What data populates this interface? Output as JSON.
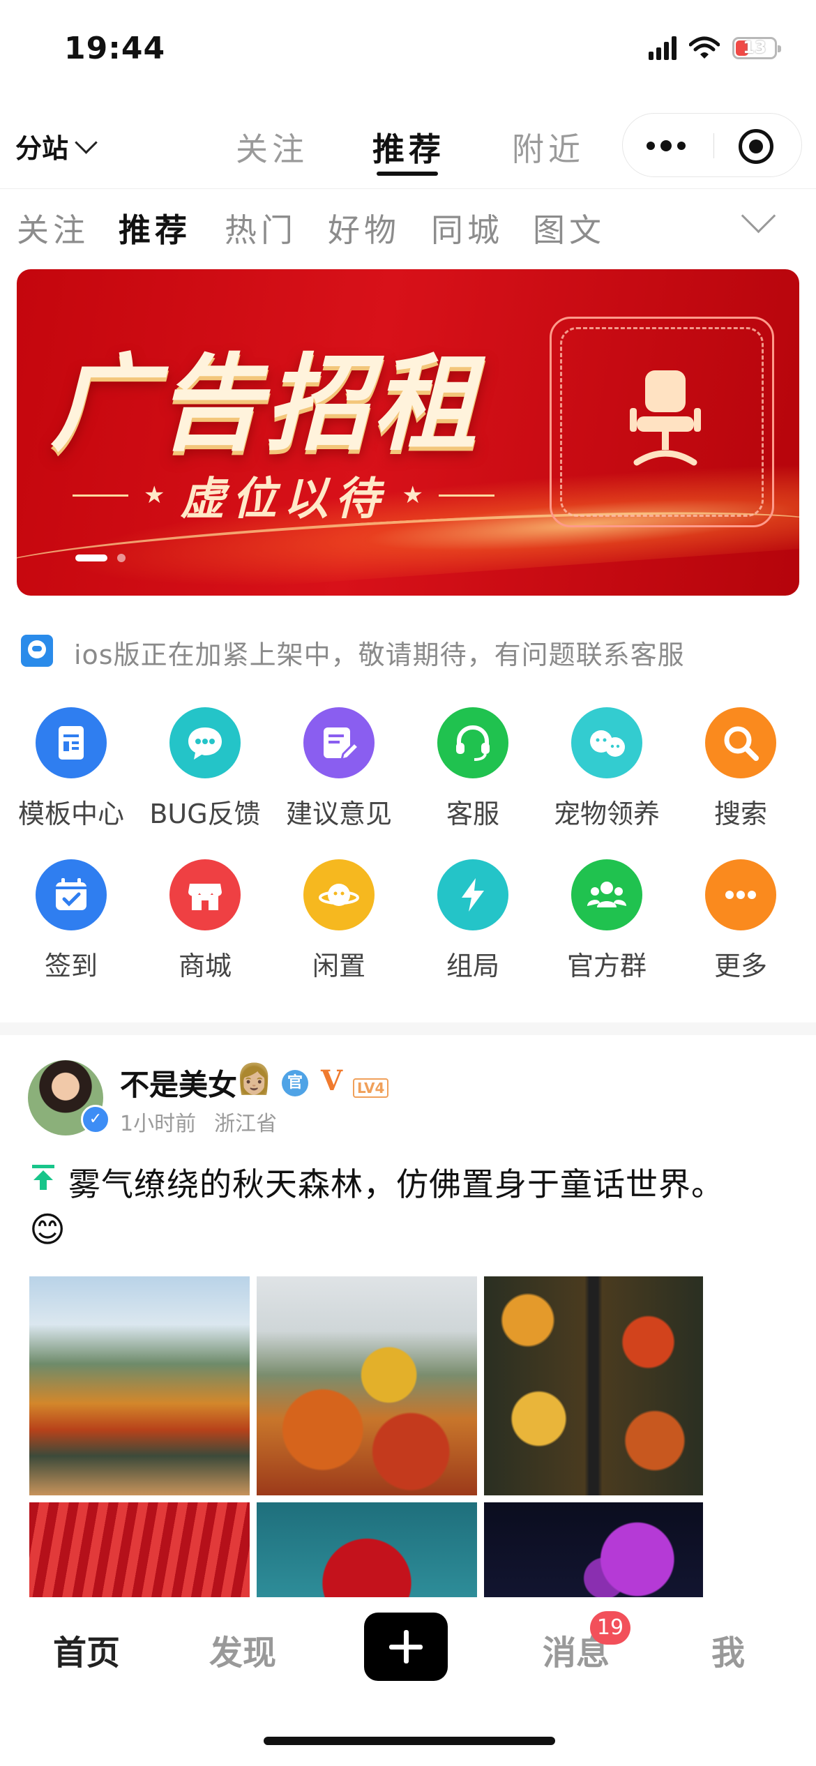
{
  "status": {
    "time": "19:44",
    "battery": "13"
  },
  "topnav": {
    "station": "分站",
    "tabs": [
      "关注",
      "推荐",
      "附近"
    ],
    "active_tab": "推荐"
  },
  "category_tabs": [
    "关注",
    "推荐",
    "热门",
    "好物",
    "同城",
    "图文"
  ],
  "banner": {
    "title": "广告招租",
    "subtitle": "虚位以待"
  },
  "notice": "ios版正在加紧上架中，敬请期待，有问题联系客服",
  "grid": [
    {
      "label": "模板中心",
      "icon": "template-doc-icon",
      "color": "#2f7ef0"
    },
    {
      "label": "BUG反馈",
      "icon": "chat-bubble-icon",
      "color": "#24c4c8"
    },
    {
      "label": "建议意见",
      "icon": "edit-note-icon",
      "color": "#8a5ef0"
    },
    {
      "label": "客服",
      "icon": "headset-icon",
      "color": "#20c24f"
    },
    {
      "label": "宠物领养",
      "icon": "pets-icon",
      "color": "#33ccd0"
    },
    {
      "label": "搜索",
      "icon": "search-icon",
      "color": "#fa8a1e"
    },
    {
      "label": "签到",
      "icon": "calendar-check-icon",
      "color": "#2f7ef0"
    },
    {
      "label": "商城",
      "icon": "store-icon",
      "color": "#ef4043"
    },
    {
      "label": "闲置",
      "icon": "planet-icon",
      "color": "#f6b81f"
    },
    {
      "label": "组局",
      "icon": "lightning-icon",
      "color": "#24c4c8"
    },
    {
      "label": "官方群",
      "icon": "group-icon",
      "color": "#20c24f"
    },
    {
      "label": "更多",
      "icon": "more-dots-icon",
      "color": "#fa8a1e"
    }
  ],
  "post": {
    "username": "不是美女",
    "user_emoji": "👩🏼",
    "badge_official": "官",
    "badge_v": "V",
    "badge_level": "LV4",
    "time_ago": "1小时前",
    "location": "浙江省",
    "text": "雾气缭绕的秋天森林，仿佛置身于童话世界。",
    "emoji": "😊"
  },
  "tabbar": {
    "tabs": [
      "首页",
      "发现",
      "消息",
      "我"
    ],
    "active": "首页",
    "message_badge": "19"
  }
}
